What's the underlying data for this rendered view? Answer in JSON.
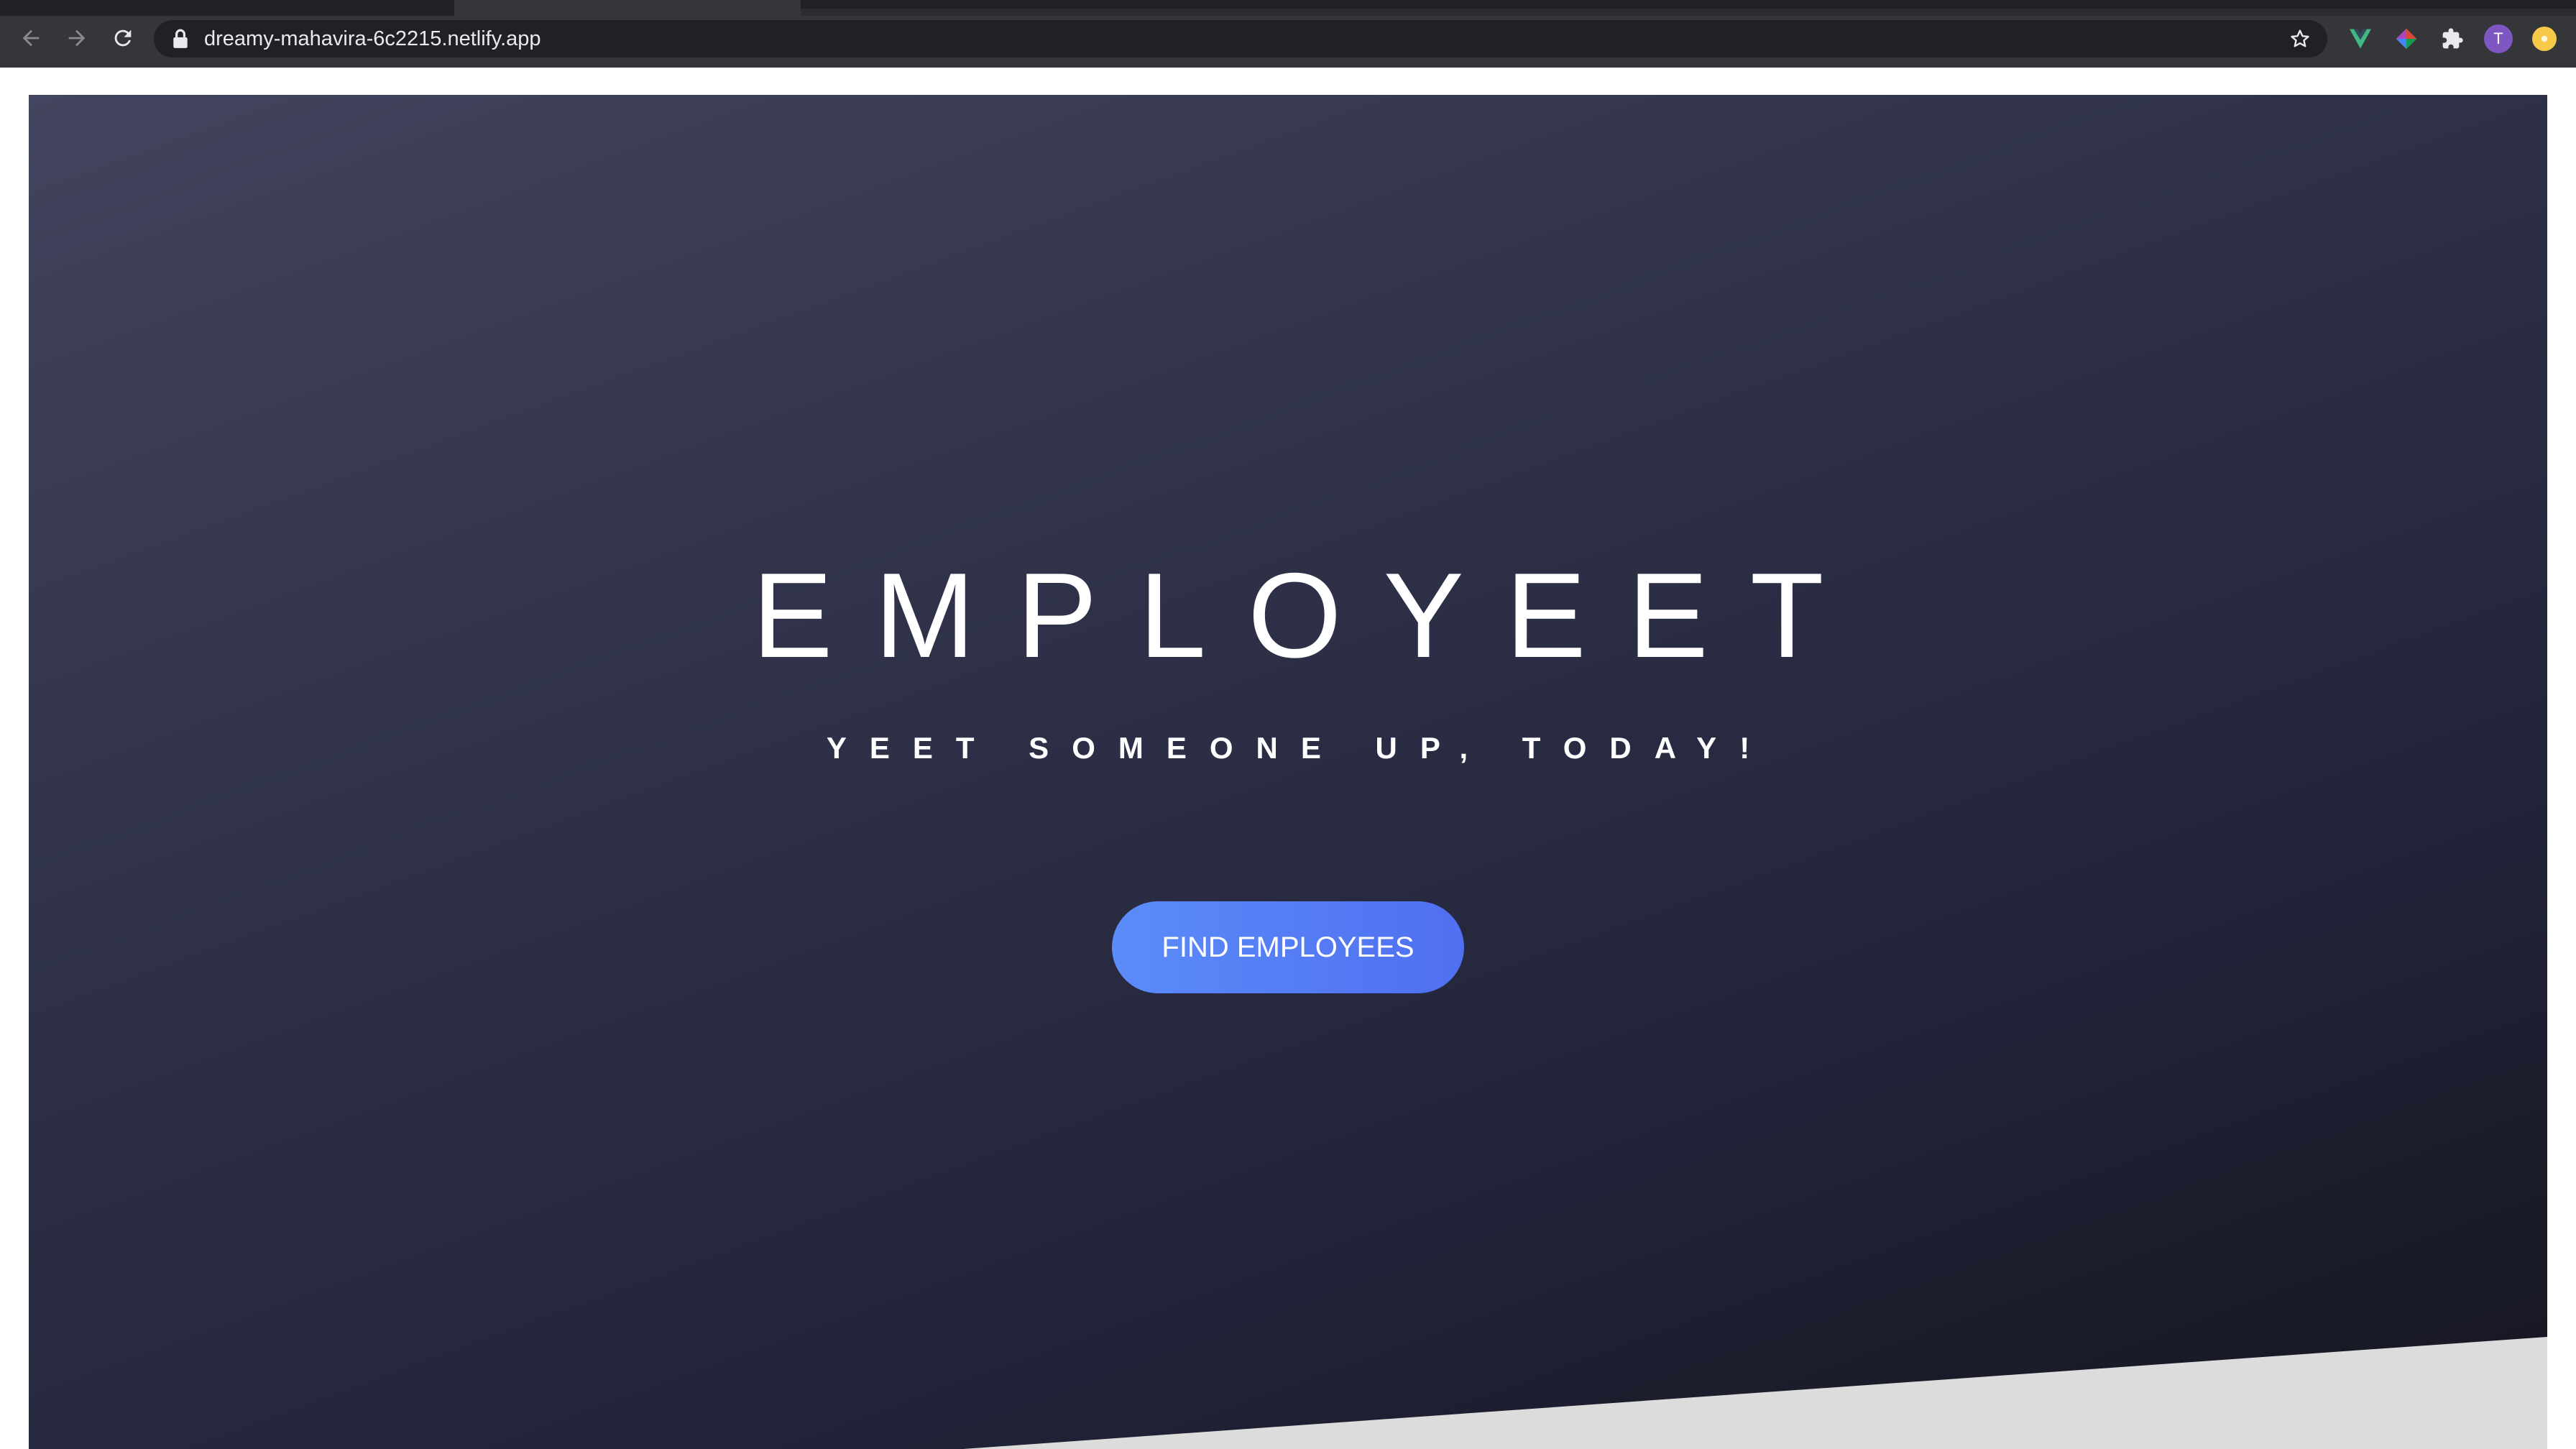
{
  "browser": {
    "url": "dreamy-mahavira-6c2215.netlify.app",
    "icons": {
      "back": "back-arrow-icon",
      "forward": "forward-arrow-icon",
      "reload": "reload-icon",
      "lock": "lock-icon",
      "bookmark": "star-icon",
      "extensions": [
        "vue-devtools-icon",
        "color-picker-extension-icon",
        "puzzle-icon"
      ],
      "profile_initial": "T",
      "update": "update-icon"
    }
  },
  "hero": {
    "title": "EMPLOYEET",
    "subtitle": "YEET SOMEONE UP, TODAY!",
    "cta_label": "FIND EMPLOYEES"
  },
  "colors": {
    "hero_gradient_start": "#43445f",
    "hero_gradient_end": "#15161f",
    "cta_start": "#5b8cf9",
    "cta_end": "#4f6ff0",
    "slant": "#dcdcdc"
  }
}
